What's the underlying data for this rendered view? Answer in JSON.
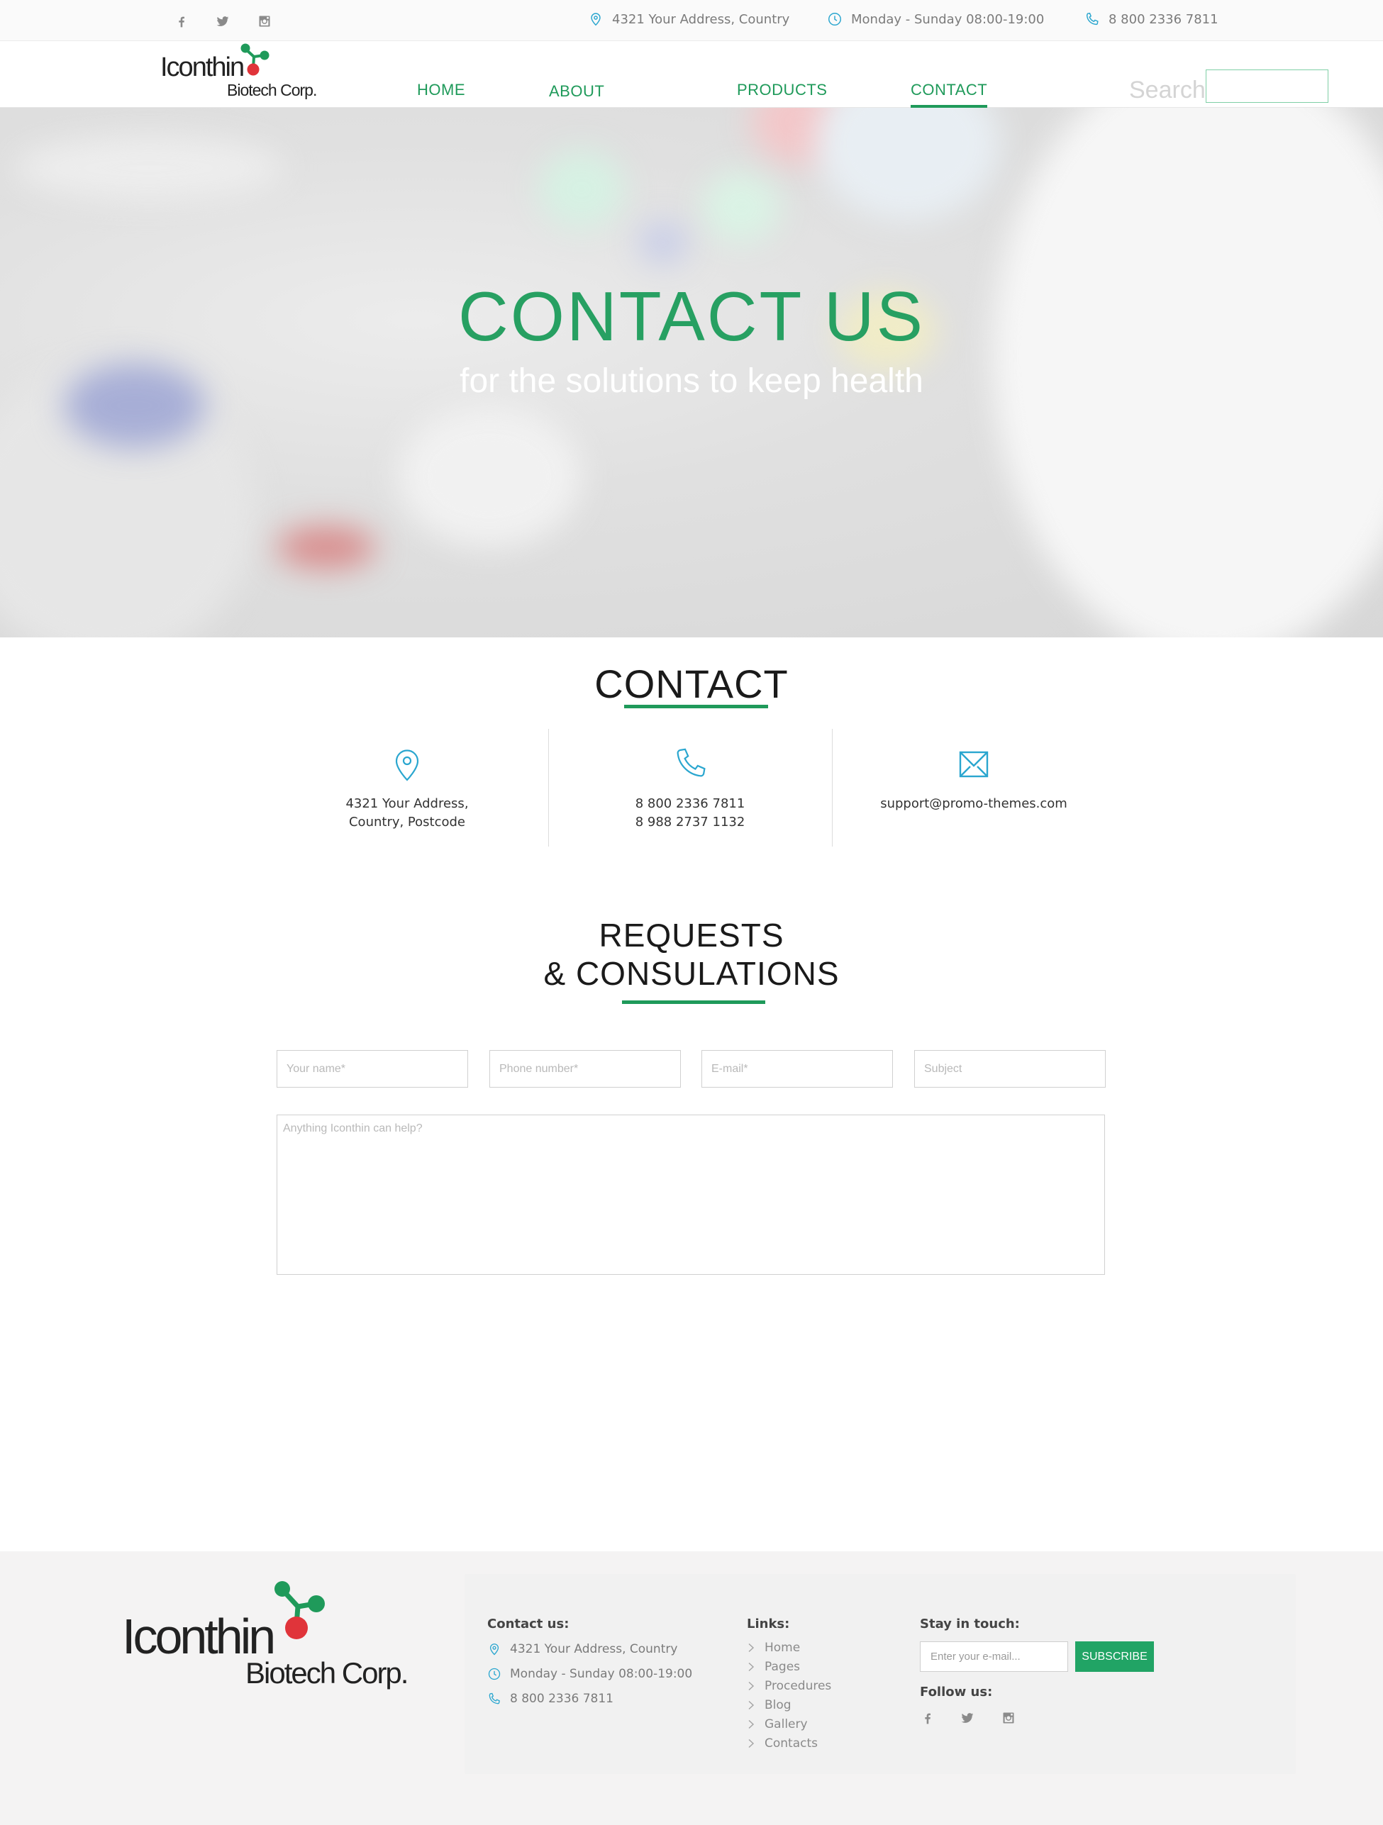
{
  "topbar": {
    "social_icons": [
      "facebook-icon",
      "twitter-icon",
      "instagram-icon"
    ],
    "address": "4321 Your Address, Country",
    "hours": "Monday - Sunday 08:00-19:00",
    "phone": "8 800 2336 7811"
  },
  "header": {
    "logo_line1": "Iconthin",
    "logo_line2": "Biotech Corp.",
    "nav": [
      "HOME",
      "ABOUT",
      "PRODUCTS",
      "CONTACT"
    ],
    "active_nav": "CONTACT",
    "search_label": "Search",
    "search_value": ""
  },
  "hero": {
    "title": "CONTACT US",
    "subtitle": "for the solutions to keep health"
  },
  "contact": {
    "title": "CONTACT",
    "address_line1": "4321 Your Address,",
    "address_line2": "Country, Postcode",
    "phone1": "8 800 2336 7811",
    "phone2": "8 988 2737 1132",
    "email": "support@promo-themes.com"
  },
  "requests": {
    "title_line1": "REQUESTS",
    "title_line2": "& CONSULATIONS",
    "name_placeholder": "Your name*",
    "phone_placeholder": "Phone number*",
    "email_placeholder": "E-mail*",
    "subject_placeholder": "Subject",
    "message_placeholder": "Anything Iconthin can help?"
  },
  "footer": {
    "logo_line1": "Iconthin",
    "logo_line2": "Biotech Corp.",
    "contact_heading": "Contact us:",
    "address": "4321 Your Address, Country",
    "hours": "Monday - Sunday 08:00-19:00",
    "phone": "8 800 2336 7811",
    "links_heading": "Links:",
    "links": [
      "Home",
      "Pages",
      "Procedures",
      "Blog",
      "Gallery",
      "Contacts"
    ],
    "stay_heading": "Stay in touch:",
    "email_placeholder": "Enter your e-mail...",
    "subscribe_label": "SUBSCRIBE",
    "follow_heading": "Follow us:"
  },
  "colors": {
    "brand_green": "#1f9a5a",
    "icon_blue": "#2aa6cf",
    "logo_red": "#e0343a",
    "footer_bg": "#f4f3f3"
  }
}
